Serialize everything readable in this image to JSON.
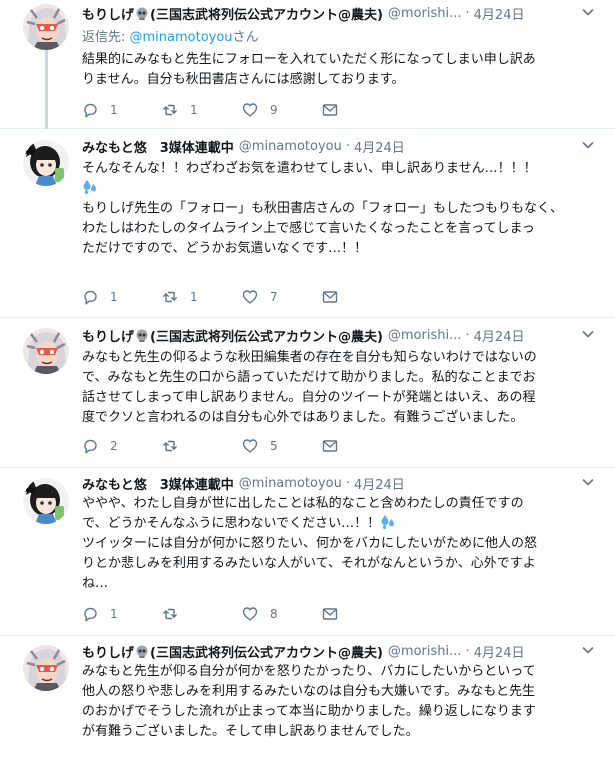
{
  "colors": {
    "accent": "#1da1f2",
    "muted": "#657786",
    "divider": "#e6ecf0",
    "thread": "#ccd6dd"
  },
  "icons": {
    "reply": "reply-icon",
    "retweet": "retweet-icon",
    "like": "heart-icon",
    "dm": "envelope-icon",
    "caret": "chevron-down-icon",
    "skull": "skull-emoji",
    "drops": "sweat-droplets-emoji"
  },
  "replying": {
    "prefix": "返信先: ",
    "handle": "@minamotoyou",
    "suffix": "さん"
  },
  "tweets": [
    {
      "name_pre": "もりしげ",
      "name_post": "(三国志武将列伝公式アカウント@農夫)",
      "handle": "@morishi...",
      "date": "4月24日",
      "lines": [
        "結果的にみなもと先生にフォローを入れていただく形になってしまい申し訳あ",
        "りません。自分も秋田書店さんには感謝しております。"
      ],
      "replies": "1",
      "retweets": "1",
      "likes": "9"
    },
    {
      "name": "みなもと悠　3媒体連載中",
      "handle": "@minamotoyou",
      "date": "4月24日",
      "lines": [
        "そんなそんな！！わざわざお気を遣わせてしまい、申し訳ありません…！！！",
        "",
        "もりしげ先生の「フォロー」も秋田書店さんの「フォロー」もしたつもりもなく、",
        "わたしはわたしのタイムライン上で感じて言いたくなったことを言ってしまっ",
        "ただけですので、どうかお気遣いなくです…！！"
      ],
      "replies": "1",
      "retweets": "1",
      "likes": "7"
    },
    {
      "name_pre": "もりしげ",
      "name_post": "(三国志武将列伝公式アカウント@農夫)",
      "handle": "@morishi...",
      "date": "4月24日",
      "lines": [
        "みなもと先生の仰るような秋田編集者の存在を自分も知らないわけではないの",
        "で、みなもと先生の口から語っていただけて助かりました。私的なことまでお",
        "話させてしまって申し訳ありません。自分のツイートが発端とはいえ、あの程",
        "度でクソと言われるのは自分も心外ではありました。有難うございました。"
      ],
      "replies": "2",
      "retweets": "",
      "likes": "5"
    },
    {
      "name": "みなもと悠　3媒体連載中",
      "handle": "@minamotoyou",
      "date": "4月24日",
      "lines": [
        "ややや、わたし自身が世に出したことは私的なこと含めわたしの責任ですの",
        "で、どうかそんなふうに思わないでください…！！",
        "ツイッターには自分が何かに怒りたい、何かをバカにしたいがために他人の怒",
        "りとか悲しみを利用するみたいな人がいて、それがなんというか、心外ですよ",
        "ね…"
      ],
      "replies": "1",
      "retweets": "",
      "likes": "8"
    },
    {
      "name_pre": "もりしげ",
      "name_post": "(三国志武将列伝公式アカウント@農夫)",
      "handle": "@morishi...",
      "date": "4月24日",
      "lines": [
        "みなもと先生が仰る自分が何かを怒りたかったり、バカにしたいからといって",
        "他人の怒りや悲しみを利用するみたいなのは自分も大嫌いです。みなもと先生",
        "のおかげでそうした流れが止まって本当に助かりました。繰り返しになります",
        "が有難うございました。そして申し訳ありませんでした。"
      ],
      "replies": "",
      "retweets": "",
      "likes": ""
    }
  ]
}
